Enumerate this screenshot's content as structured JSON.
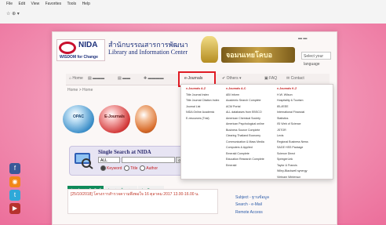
{
  "browser": {
    "menu": [
      "File",
      "Edit",
      "View",
      "Favorites",
      "Tools",
      "Help"
    ]
  },
  "social": [
    "f",
    "rss",
    "t",
    "yt"
  ],
  "header": {
    "logo_text": "NIDA",
    "logo_sub": "WISDOM for Change",
    "site_thai": "สำนักบรรณสารการพัฒนา",
    "site_en": "Library and Information Center",
    "banner_text": "จอมนเทยโคบอ",
    "lang_select": "Select your language"
  },
  "nav": {
    "home": "Home",
    "e_journals": "e-Journals",
    "others": "Others",
    "faq": "FAQ",
    "contact": "Contact"
  },
  "breadcrumb": "Home > Home",
  "tiles": {
    "opac": "OPAC",
    "ejournals": "E-Journals"
  },
  "search": {
    "title": "Single Search at NIDA",
    "scope": "ALL",
    "go": "Go",
    "options": [
      "Keyword",
      "Title",
      "Author"
    ]
  },
  "news": {
    "tabs": [
      "ข่าวประชาสัมพันธ์",
      "ข่าวสารห้องสมุด",
      "ข่าวกิจกรรม"
    ],
    "item": "[25/10/2018] โครงการสำรวจความพึงพอใจ 16 ตุลาคม 2017 13.00-16.00 น."
  },
  "side": {
    "row1": "Subject - ฐานข้อมูล",
    "row2": "Search - e-Mail",
    "row3": "Remote Access"
  },
  "dropdown": {
    "col1": {
      "head": "e-Journals A-Z",
      "items": [
        "Title Journal Index",
        "Title Journal Citation Index",
        "Journal List",
        "NIDA Online Academic",
        "E-resources (Trial)"
      ]
    },
    "col2": {
      "head": "e-Journals A-C",
      "items": [
        "ABI Inform",
        "Academic Search Complete",
        "ACM Portal",
        "ALL databases from EBSCO",
        "American Chemical Society",
        "American Psychological online",
        "Business Source Complete",
        "Clearing Thailand Economy",
        "Communication & Mass Media",
        "Computers & Applied",
        "Emerald Complete",
        "Education Research Complete",
        "Emerald"
      ]
    },
    "col3": {
      "head": "e-Journals K-Z",
      "items": [
        "H.W. Wilson",
        "Hospitality & Tourism",
        "IEL/IEEE",
        "International Financial",
        "Statistics",
        "ISI Web of Science",
        "JSTOR",
        "Lexis",
        "Regional Business News",
        "SAGE HSS Package",
        "Science Direct",
        "SpringerLink",
        "Taylor & Francis",
        "Wiley-Blackwell synergy",
        "Vietnam Wintersun"
      ]
    }
  }
}
